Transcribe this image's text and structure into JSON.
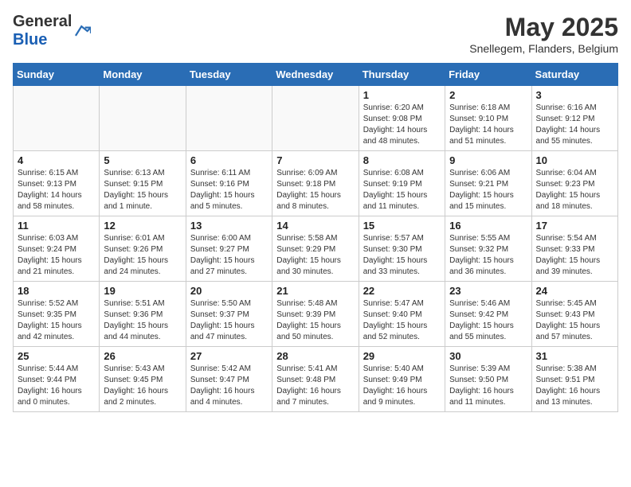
{
  "header": {
    "logo_general": "General",
    "logo_blue": "Blue",
    "month": "May 2025",
    "location": "Snellegem, Flanders, Belgium"
  },
  "weekdays": [
    "Sunday",
    "Monday",
    "Tuesday",
    "Wednesday",
    "Thursday",
    "Friday",
    "Saturday"
  ],
  "weeks": [
    [
      {
        "day": "",
        "info": ""
      },
      {
        "day": "",
        "info": ""
      },
      {
        "day": "",
        "info": ""
      },
      {
        "day": "",
        "info": ""
      },
      {
        "day": "1",
        "info": "Sunrise: 6:20 AM\nSunset: 9:08 PM\nDaylight: 14 hours\nand 48 minutes."
      },
      {
        "day": "2",
        "info": "Sunrise: 6:18 AM\nSunset: 9:10 PM\nDaylight: 14 hours\nand 51 minutes."
      },
      {
        "day": "3",
        "info": "Sunrise: 6:16 AM\nSunset: 9:12 PM\nDaylight: 14 hours\nand 55 minutes."
      }
    ],
    [
      {
        "day": "4",
        "info": "Sunrise: 6:15 AM\nSunset: 9:13 PM\nDaylight: 14 hours\nand 58 minutes."
      },
      {
        "day": "5",
        "info": "Sunrise: 6:13 AM\nSunset: 9:15 PM\nDaylight: 15 hours\nand 1 minute."
      },
      {
        "day": "6",
        "info": "Sunrise: 6:11 AM\nSunset: 9:16 PM\nDaylight: 15 hours\nand 5 minutes."
      },
      {
        "day": "7",
        "info": "Sunrise: 6:09 AM\nSunset: 9:18 PM\nDaylight: 15 hours\nand 8 minutes."
      },
      {
        "day": "8",
        "info": "Sunrise: 6:08 AM\nSunset: 9:19 PM\nDaylight: 15 hours\nand 11 minutes."
      },
      {
        "day": "9",
        "info": "Sunrise: 6:06 AM\nSunset: 9:21 PM\nDaylight: 15 hours\nand 15 minutes."
      },
      {
        "day": "10",
        "info": "Sunrise: 6:04 AM\nSunset: 9:23 PM\nDaylight: 15 hours\nand 18 minutes."
      }
    ],
    [
      {
        "day": "11",
        "info": "Sunrise: 6:03 AM\nSunset: 9:24 PM\nDaylight: 15 hours\nand 21 minutes."
      },
      {
        "day": "12",
        "info": "Sunrise: 6:01 AM\nSunset: 9:26 PM\nDaylight: 15 hours\nand 24 minutes."
      },
      {
        "day": "13",
        "info": "Sunrise: 6:00 AM\nSunset: 9:27 PM\nDaylight: 15 hours\nand 27 minutes."
      },
      {
        "day": "14",
        "info": "Sunrise: 5:58 AM\nSunset: 9:29 PM\nDaylight: 15 hours\nand 30 minutes."
      },
      {
        "day": "15",
        "info": "Sunrise: 5:57 AM\nSunset: 9:30 PM\nDaylight: 15 hours\nand 33 minutes."
      },
      {
        "day": "16",
        "info": "Sunrise: 5:55 AM\nSunset: 9:32 PM\nDaylight: 15 hours\nand 36 minutes."
      },
      {
        "day": "17",
        "info": "Sunrise: 5:54 AM\nSunset: 9:33 PM\nDaylight: 15 hours\nand 39 minutes."
      }
    ],
    [
      {
        "day": "18",
        "info": "Sunrise: 5:52 AM\nSunset: 9:35 PM\nDaylight: 15 hours\nand 42 minutes."
      },
      {
        "day": "19",
        "info": "Sunrise: 5:51 AM\nSunset: 9:36 PM\nDaylight: 15 hours\nand 44 minutes."
      },
      {
        "day": "20",
        "info": "Sunrise: 5:50 AM\nSunset: 9:37 PM\nDaylight: 15 hours\nand 47 minutes."
      },
      {
        "day": "21",
        "info": "Sunrise: 5:48 AM\nSunset: 9:39 PM\nDaylight: 15 hours\nand 50 minutes."
      },
      {
        "day": "22",
        "info": "Sunrise: 5:47 AM\nSunset: 9:40 PM\nDaylight: 15 hours\nand 52 minutes."
      },
      {
        "day": "23",
        "info": "Sunrise: 5:46 AM\nSunset: 9:42 PM\nDaylight: 15 hours\nand 55 minutes."
      },
      {
        "day": "24",
        "info": "Sunrise: 5:45 AM\nSunset: 9:43 PM\nDaylight: 15 hours\nand 57 minutes."
      }
    ],
    [
      {
        "day": "25",
        "info": "Sunrise: 5:44 AM\nSunset: 9:44 PM\nDaylight: 16 hours\nand 0 minutes."
      },
      {
        "day": "26",
        "info": "Sunrise: 5:43 AM\nSunset: 9:45 PM\nDaylight: 16 hours\nand 2 minutes."
      },
      {
        "day": "27",
        "info": "Sunrise: 5:42 AM\nSunset: 9:47 PM\nDaylight: 16 hours\nand 4 minutes."
      },
      {
        "day": "28",
        "info": "Sunrise: 5:41 AM\nSunset: 9:48 PM\nDaylight: 16 hours\nand 7 minutes."
      },
      {
        "day": "29",
        "info": "Sunrise: 5:40 AM\nSunset: 9:49 PM\nDaylight: 16 hours\nand 9 minutes."
      },
      {
        "day": "30",
        "info": "Sunrise: 5:39 AM\nSunset: 9:50 PM\nDaylight: 16 hours\nand 11 minutes."
      },
      {
        "day": "31",
        "info": "Sunrise: 5:38 AM\nSunset: 9:51 PM\nDaylight: 16 hours\nand 13 minutes."
      }
    ]
  ]
}
